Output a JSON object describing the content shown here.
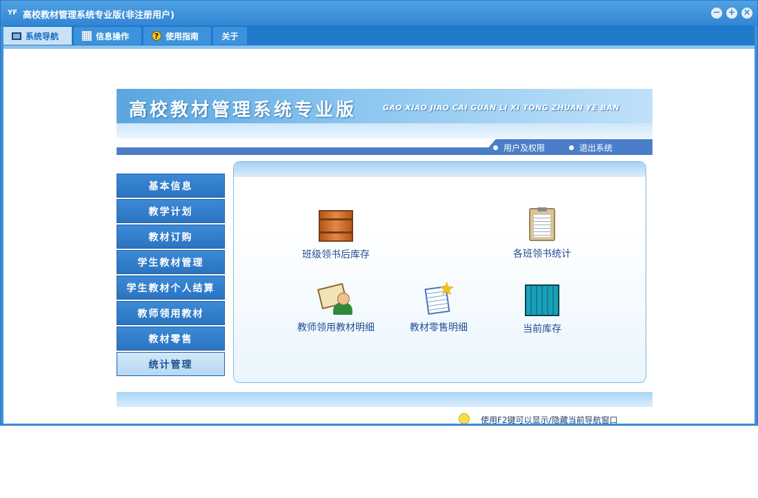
{
  "window": {
    "title": "高校教材管理系统专业版(非注册用户)",
    "app_icon_text": "YF",
    "controls": {
      "minimize": "−",
      "maximize": "+",
      "close": "×"
    }
  },
  "tabs": [
    {
      "label": "系统导航",
      "icon": "monitor-icon",
      "active": true
    },
    {
      "label": "信息操作",
      "icon": "grid-icon",
      "active": false
    },
    {
      "label": "使用指南",
      "icon": "help-icon",
      "active": false
    },
    {
      "label": "关于",
      "active": false
    }
  ],
  "banner": {
    "title": "高校教材管理系统专业版",
    "subtitle": "GAO XIAO JIAO CAI GUAN LI XI TONG ZHUAN YE BAN"
  },
  "user_links": {
    "permissions": "用户及权限",
    "logout": "退出系统"
  },
  "menu": [
    {
      "label": "基本信息",
      "active": false
    },
    {
      "label": "教学计划",
      "active": false
    },
    {
      "label": "教材订购",
      "active": false
    },
    {
      "label": "学生教材管理",
      "active": false
    },
    {
      "label": "学生教材个人结算",
      "active": false
    },
    {
      "label": "教师领用教材",
      "active": false
    },
    {
      "label": "教材零售",
      "active": false
    },
    {
      "label": "统计管理",
      "active": true
    }
  ],
  "functions": [
    {
      "label": "班级领书后库存",
      "icon": "crate-icon"
    },
    {
      "label": "各班领书统计",
      "icon": "clipboard-icon"
    },
    {
      "label": "教师领用教材明细",
      "icon": "teacher-book-icon"
    },
    {
      "label": "教材零售明细",
      "icon": "document-star-icon"
    },
    {
      "label": "当前库存",
      "icon": "stock-icon"
    }
  ],
  "footer": {
    "tip": "使用F2键可以显示/隐藏当前导航窗口"
  },
  "colors": {
    "accent": "#2b73c1",
    "frame": "#3f8fd6",
    "active_menu": "#c9e2f7"
  }
}
